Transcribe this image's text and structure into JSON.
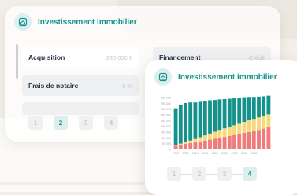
{
  "back_card": {
    "title": "Investissement immobilier",
    "rows": [
      {
        "label": "Acquisition",
        "value": "280 000 €"
      },
      {
        "label": "Frais de notaire",
        "value": "8 %"
      }
    ],
    "right_row": {
      "label": "Financement",
      "value": "Crédit"
    },
    "pages": [
      "1",
      "2",
      "3",
      "4"
    ],
    "active_page": "2"
  },
  "front_card": {
    "title": "Investissement immobilier",
    "pages": [
      "1",
      "2",
      "3",
      "4"
    ],
    "active_page": "4"
  },
  "colors": {
    "teal": "#14938c",
    "yellow": "#f6d878",
    "red": "#f07b7b",
    "active_bg": "#dcefee"
  },
  "icons": [
    "house-icon"
  ],
  "chart_data": {
    "type": "bar",
    "stacked": true,
    "categories": [
      "2020",
      "2021",
      "2022",
      "2023",
      "2024",
      "2025",
      "2026",
      "2027",
      "2028",
      "2029",
      "2030",
      "2031",
      "2032",
      "2033",
      "2034",
      "2035",
      "2036",
      "2037",
      "2038",
      "2039"
    ],
    "x_tick_labels": [
      "2020",
      "2022",
      "2024",
      "2026",
      "2028",
      "2030",
      "2032",
      "2034",
      "2036"
    ],
    "y_tick_labels": [
      "850 000",
      "750 000",
      "650 000",
      "550 000",
      "450 000",
      "350 000",
      "250 000",
      "150 000",
      "50 000",
      "0"
    ],
    "ylim": [
      0,
      850000
    ],
    "series": [
      {
        "color": "#f07b7b",
        "values": [
          60000,
          75000,
          90000,
          105000,
          115000,
          130000,
          145000,
          160000,
          175000,
          190000,
          205000,
          220000,
          235000,
          250000,
          270000,
          285000,
          300000,
          320000,
          340000,
          360000
        ]
      },
      {
        "color": "#f6d878",
        "values": [
          15000,
          20000,
          30000,
          40000,
          55000,
          70000,
          85000,
          100000,
          115000,
          130000,
          140000,
          150000,
          160000,
          170000,
          180000,
          190000,
          200000,
          205000,
          210000,
          215000
        ]
      },
      {
        "color": "#14938c",
        "values": [
          600000,
          630000,
          640000,
          625000,
          600000,
          580000,
          560000,
          545000,
          520000,
          500000,
          480000,
          460000,
          445000,
          425000,
          405000,
          385000,
          360000,
          340000,
          320000,
          305000
        ]
      }
    ],
    "grid": false,
    "legend": "none"
  }
}
